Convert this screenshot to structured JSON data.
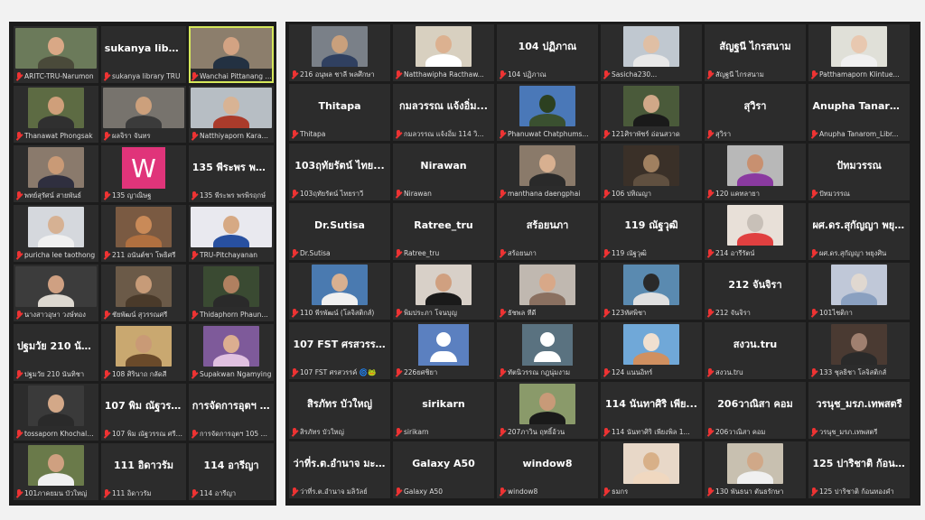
{
  "meeting": {
    "left_panel": [
      {
        "name": "ARITC-TRU-Narumon",
        "kind": "video",
        "bg": "#6b7a5a",
        "skin": "#d9a886",
        "shirt": "#4a4a3a",
        "wide": true
      },
      {
        "name": "sukanya library TRU",
        "kind": "text",
        "text": "sukanya library TRU"
      },
      {
        "name": "Wanchai Pittanang ARITC",
        "kind": "video",
        "bg": "#8c7e6c",
        "skin": "#d3a383",
        "shirt": "#233142",
        "wide": true,
        "active": true
      },
      {
        "name": "Thanawat Phongsak",
        "kind": "video",
        "bg": "#5d6b43",
        "skin": "#cf9f7a",
        "shirt": "#303030"
      },
      {
        "name": "ผลจิรา จันทร",
        "kind": "video",
        "bg": "#77736d",
        "skin": "#cca07c",
        "shirt": "#3b3b3b",
        "wide": true
      },
      {
        "name": "Natthiyaporn Karaket",
        "kind": "video",
        "bg": "#b7bec4",
        "skin": "#d8b394",
        "shirt": "#aa3b2b",
        "wide": true
      },
      {
        "name": "พทย์สุรัศน์ สายพันธ์",
        "kind": "video",
        "bg": "#8a7a6c",
        "skin": "#c99a76",
        "shirt": "#2f2f3f"
      },
      {
        "name": "135 ญาณิษฐ",
        "kind": "letter",
        "letter": "W"
      },
      {
        "name": "135 พีระพร พรพิรฤกษ์",
        "kind": "text",
        "text": "135 พีระพร พรพิ..."
      },
      {
        "name": "puricha lee taothong",
        "kind": "video",
        "bg": "#d5d8dd",
        "skin": "#d6b193",
        "shirt": "#f0f0f0"
      },
      {
        "name": "211 อนันต์ชา โพธิศรี",
        "kind": "video",
        "bg": "#7a5a42",
        "skin": "#c98a58",
        "shirt": "#b07040"
      },
      {
        "name": "TRU-Pitchayanan",
        "kind": "video",
        "bg": "#e9e9ef",
        "skin": "#d6a984",
        "shirt": "#2850a0",
        "wide": true
      },
      {
        "name": "นางสาวอุษา วงษ์ทอง",
        "kind": "video",
        "bg": "#3c3c3c",
        "skin": "#cfa082",
        "shirt": "#ddd8d0",
        "wide": true
      },
      {
        "name": "ชัยพัฒน์ สุวรรณศรี",
        "kind": "video",
        "bg": "#6b5a48",
        "skin": "#c79b78",
        "shirt": "#4a3a2a"
      },
      {
        "name": "Thidaphorn Phaungth...",
        "kind": "video",
        "bg": "#3a4a32",
        "skin": "#b08060",
        "shirt": "#2a2a2a"
      },
      {
        "name": "ปฐมวัย 210 นันทิชา",
        "kind": "text",
        "text": "ปฐมวัย 210 นันทิชา"
      },
      {
        "name": "108 ศิรินาถ กลัดสี",
        "kind": "video",
        "bg": "#c9a870",
        "skin": "#c99a76",
        "shirt": "#6a4a2a"
      },
      {
        "name": "Supakwan Ngamying",
        "kind": "video",
        "bg": "#7e5a9a",
        "skin": "#dcae90",
        "shirt": "#e0c0e0"
      },
      {
        "name": "tossaporn Khochalam",
        "kind": "video",
        "bg": "#3a3a3a",
        "skin": "#d3a888",
        "shirt": "#2a2a2a"
      },
      {
        "name": "107 พิม ณัฐวรรณ ศรีสุข",
        "kind": "text",
        "text": "107 พิม ณัฐวรรณ..."
      },
      {
        "name": "การจัดการอุตฯ 105 ณัฐ...",
        "kind": "text",
        "text": "การจัดการอุตฯ 1..."
      },
      {
        "name": "101ภาคยมน บัวใหญ่",
        "kind": "video",
        "bg": "#6a7a4a",
        "skin": "#cfa080",
        "shirt": "#f0f0f0"
      },
      {
        "name": "111 อิดาวรัม",
        "kind": "text",
        "text": "111 อิดาวรัม"
      },
      {
        "name": "114 อารีญา",
        "kind": "text",
        "text": "114 อารีญา"
      }
    ],
    "right_panel": [
      {
        "name": "216 อนุพล ชาลี พลศึกษา",
        "kind": "video",
        "bg": "#7a8088",
        "skin": "#c9a07c",
        "shirt": "#304060"
      },
      {
        "name": "Natthawipha Racthaw...",
        "kind": "video",
        "bg": "#d8d0c0",
        "skin": "#dcb190",
        "shirt": "#fff"
      },
      {
        "name": "104 ปฏิภาณ",
        "kind": "text",
        "text": "104 ปฏิภาณ"
      },
      {
        "name": "Sasicha230...",
        "kind": "video",
        "bg": "#c0c8d0",
        "skin": "#e0bfa4",
        "shirt": "#e8e8e8"
      },
      {
        "name": "สัญฐนี ไกรสนาม",
        "kind": "text",
        "text": "สัญฐนี ไกรสนาม"
      },
      {
        "name": "Patthamaporn Klintue...",
        "kind": "video",
        "bg": "#e0e0d8",
        "skin": "#e8c8b0",
        "shirt": "#f0f0f0"
      },
      {
        "name": "Thitapa",
        "kind": "text",
        "text": "Thitapa"
      },
      {
        "name": "กมลวรรณ แจ้งอิ่ม 114 วิ...",
        "kind": "text",
        "text": "กมลวรรณ แจ้งอิ่ม..."
      },
      {
        "name": "Phanuwat Chatphums...",
        "kind": "video",
        "bg": "#4a78b8",
        "skin": "#2c4020",
        "shirt": "#3a5030"
      },
      {
        "name": "121ศิราพัชร์ อ่อนสวาด",
        "kind": "video",
        "bg": "#4a5a3a",
        "skin": "#d0a888",
        "shirt": "#1a1a1a"
      },
      {
        "name": "สุวิรา",
        "kind": "text",
        "text": "สุวิรา"
      },
      {
        "name": "Anupha Tanarom_Libr...",
        "kind": "text",
        "text": "Anupha Tanaro..."
      },
      {
        "name": "103ฤทัยรัตน์ ไทยราวี",
        "kind": "text",
        "text": "103ฤทัยรัตน์ ไทย..."
      },
      {
        "name": "Nirawan",
        "kind": "text",
        "text": "Nirawan"
      },
      {
        "name": "manthana daengphai",
        "kind": "video",
        "bg": "#8a7a6a",
        "skin": "#d8b090",
        "shirt": "#2a2a2a"
      },
      {
        "name": "106 ปทิณญา",
        "kind": "video",
        "bg": "#3a3028",
        "skin": "#a08060",
        "shirt": "#605040"
      },
      {
        "name": "120 แคทลายา",
        "kind": "video",
        "bg": "#b8b8b8",
        "skin": "#c89070",
        "shirt": "#8a3aa0"
      },
      {
        "name": "ปัทมวรรณ",
        "kind": "text",
        "text": "ปัทมวรรณ"
      },
      {
        "name": "Dr.Sutisa",
        "kind": "text",
        "text": "Dr.Sutisa"
      },
      {
        "name": "Ratree_tru",
        "kind": "text",
        "text": "Ratree_tru"
      },
      {
        "name": "สร้อยนภา",
        "kind": "text",
        "text": "สร้อยนภา"
      },
      {
        "name": "119 ณัฐวุฒิ",
        "kind": "text",
        "text": "119 ณัฐวุฒิ"
      },
      {
        "name": "214 อารีรัตน์",
        "kind": "video",
        "bg": "#e8e0d8",
        "skin": "#c8c0b8",
        "shirt": "#e04040"
      },
      {
        "name": "ผศ.ดร.สุกัญญา พยุงศิน",
        "kind": "text",
        "text": "ผศ.ดร.สุกัญญา พยุงศิน"
      },
      {
        "name": "110 พีรพัฒน์ (โลจิสติกส์)",
        "kind": "video",
        "bg": "#4a7ab0",
        "skin": "#d8b090",
        "shirt": "#f0f0f0"
      },
      {
        "name": "พิมประภา โจนบุญ",
        "kind": "video",
        "bg": "#d8d0c8",
        "skin": "#d0a080",
        "shirt": "#1a1a1a"
      },
      {
        "name": "ธัชพล ทีดี",
        "kind": "video",
        "bg": "#c0b8b0",
        "skin": "#d8a888",
        "shirt": "#8a7060"
      },
      {
        "name": "123ทัศพิชา",
        "kind": "video",
        "bg": "#5a8ab0",
        "skin": "#2a2a2a",
        "shirt": "#e0e0e0"
      },
      {
        "name": "212 จันจิรา",
        "kind": "text",
        "text": "212 จันจิรา"
      },
      {
        "name": "101ไชติกา",
        "kind": "video",
        "bg": "#c0c8d8",
        "skin": "#e0d8d0",
        "shirt": "#8aa0c0"
      },
      {
        "name": "107 FST ศรสวรรค์ 🌀🐸",
        "kind": "text",
        "text": "107 FST ศรสวรร..."
      },
      {
        "name": "226ยศชิยา",
        "kind": "avatar-blue"
      },
      {
        "name": "ทัตนิวรรณ กฎนุ่มงาม",
        "kind": "avatar-grey"
      },
      {
        "name": "124 แนนอิทร์",
        "kind": "video",
        "bg": "#70a8d8",
        "skin": "#f0e0d0",
        "shirt": "#d09060"
      },
      {
        "name": "สงวน.tru",
        "kind": "text",
        "text": "สงวน.tru"
      },
      {
        "name": "133 ชุลธิชา โลจิสติกส์",
        "kind": "video",
        "bg": "#4a3a32",
        "skin": "#a08070",
        "shirt": "#2a2a2a"
      },
      {
        "name": "สิรภัทร บัวใหญ่",
        "kind": "text",
        "text": "สิรภัทร บัวใหญ่"
      },
      {
        "name": "sirikarn",
        "kind": "text",
        "text": "sirikarn"
      },
      {
        "name": "207ภาวิน ฤทธิ์อ้วน",
        "kind": "video",
        "bg": "#8a9a6a",
        "skin": "#c89a78",
        "shirt": "#1a1a1a"
      },
      {
        "name": "114 นันทาศิริ เพียงพิล 1...",
        "kind": "text",
        "text": "114 นันทาศิริ เพีย..."
      },
      {
        "name": "206วาณิสา คอม",
        "kind": "text",
        "text": "206วาณิสา คอม"
      },
      {
        "name": "วรนุช_มรภ.เทพสตรี",
        "kind": "text",
        "text": "วรนุช_มรภ.เทพสตรี"
      },
      {
        "name": "ว่าที่ร.ต.อำนาจ มลิวัลย์",
        "kind": "text",
        "text": "ว่าที่ร.ต.อำนาจ มะ..."
      },
      {
        "name": "Galaxy A50",
        "kind": "text",
        "text": "Galaxy A50"
      },
      {
        "name": "window8",
        "kind": "text",
        "text": "window8"
      },
      {
        "name": "ธมกร",
        "kind": "video",
        "bg": "#e8d8c8",
        "skin": "#d8b088",
        "shirt": "#f0d8c0"
      },
      {
        "name": "130 พันธนา ตันธรักษา",
        "kind": "video",
        "bg": "#c8c0b0",
        "skin": "#d0a888",
        "shirt": "#f0f0f0"
      },
      {
        "name": "125 ปาริชาติ ก้อนทองคำ",
        "kind": "text",
        "text": "125 ปาริชาติ ก้อน..."
      }
    ]
  }
}
